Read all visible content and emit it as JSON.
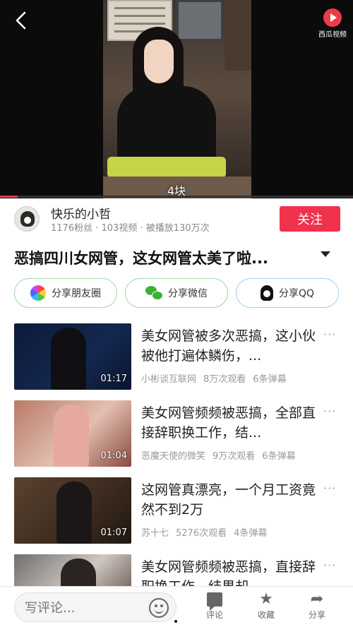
{
  "player": {
    "overlay_caption": "4块",
    "brand_name": "西瓜视频",
    "progress": 0.05
  },
  "author": {
    "name": "快乐的小哲",
    "fans": "1176粉丝",
    "videos": "103视频",
    "plays": "被播放130万次",
    "stats_sep": "·",
    "follow_label": "关注"
  },
  "video": {
    "title": "恶搞四川女网管，这女网管太美了啦..."
  },
  "share": {
    "moments": "分享朋友圈",
    "wechat": "分享微信",
    "qq": "分享QQ"
  },
  "related": [
    {
      "title": "美女网管被多次恶搞，这小伙被他打遍体鳞伤，...",
      "duration": "01:17",
      "author": "小彬谈互联网",
      "views": "8万次观看",
      "danmaku": "6条弹幕"
    },
    {
      "title": "美女网管频频被恶搞，全部直接辞职换工作，结...",
      "duration": "01:04",
      "author": "恶魔天使的微笑",
      "views": "9万次观看",
      "danmaku": "6条弹幕"
    },
    {
      "title": "这网管真漂亮，一个月工资竟然不到2万",
      "duration": "01:07",
      "author": "苏十七",
      "views": "5276次观看",
      "danmaku": "4条弹幕"
    },
    {
      "title": "美女网管频频被恶搞，直接辞职换工作，结果却...",
      "duration": "",
      "author": "",
      "views": "",
      "danmaku": ""
    }
  ],
  "more_glyph": "···",
  "bottom": {
    "comment_placeholder": "写评论...",
    "tab_comment": "评论",
    "tab_favorite": "收藏",
    "tab_share": "分享"
  },
  "colors": {
    "accent": "#f0324d",
    "brand": "#ee3b4b",
    "share_border": "#9fd6a8"
  }
}
